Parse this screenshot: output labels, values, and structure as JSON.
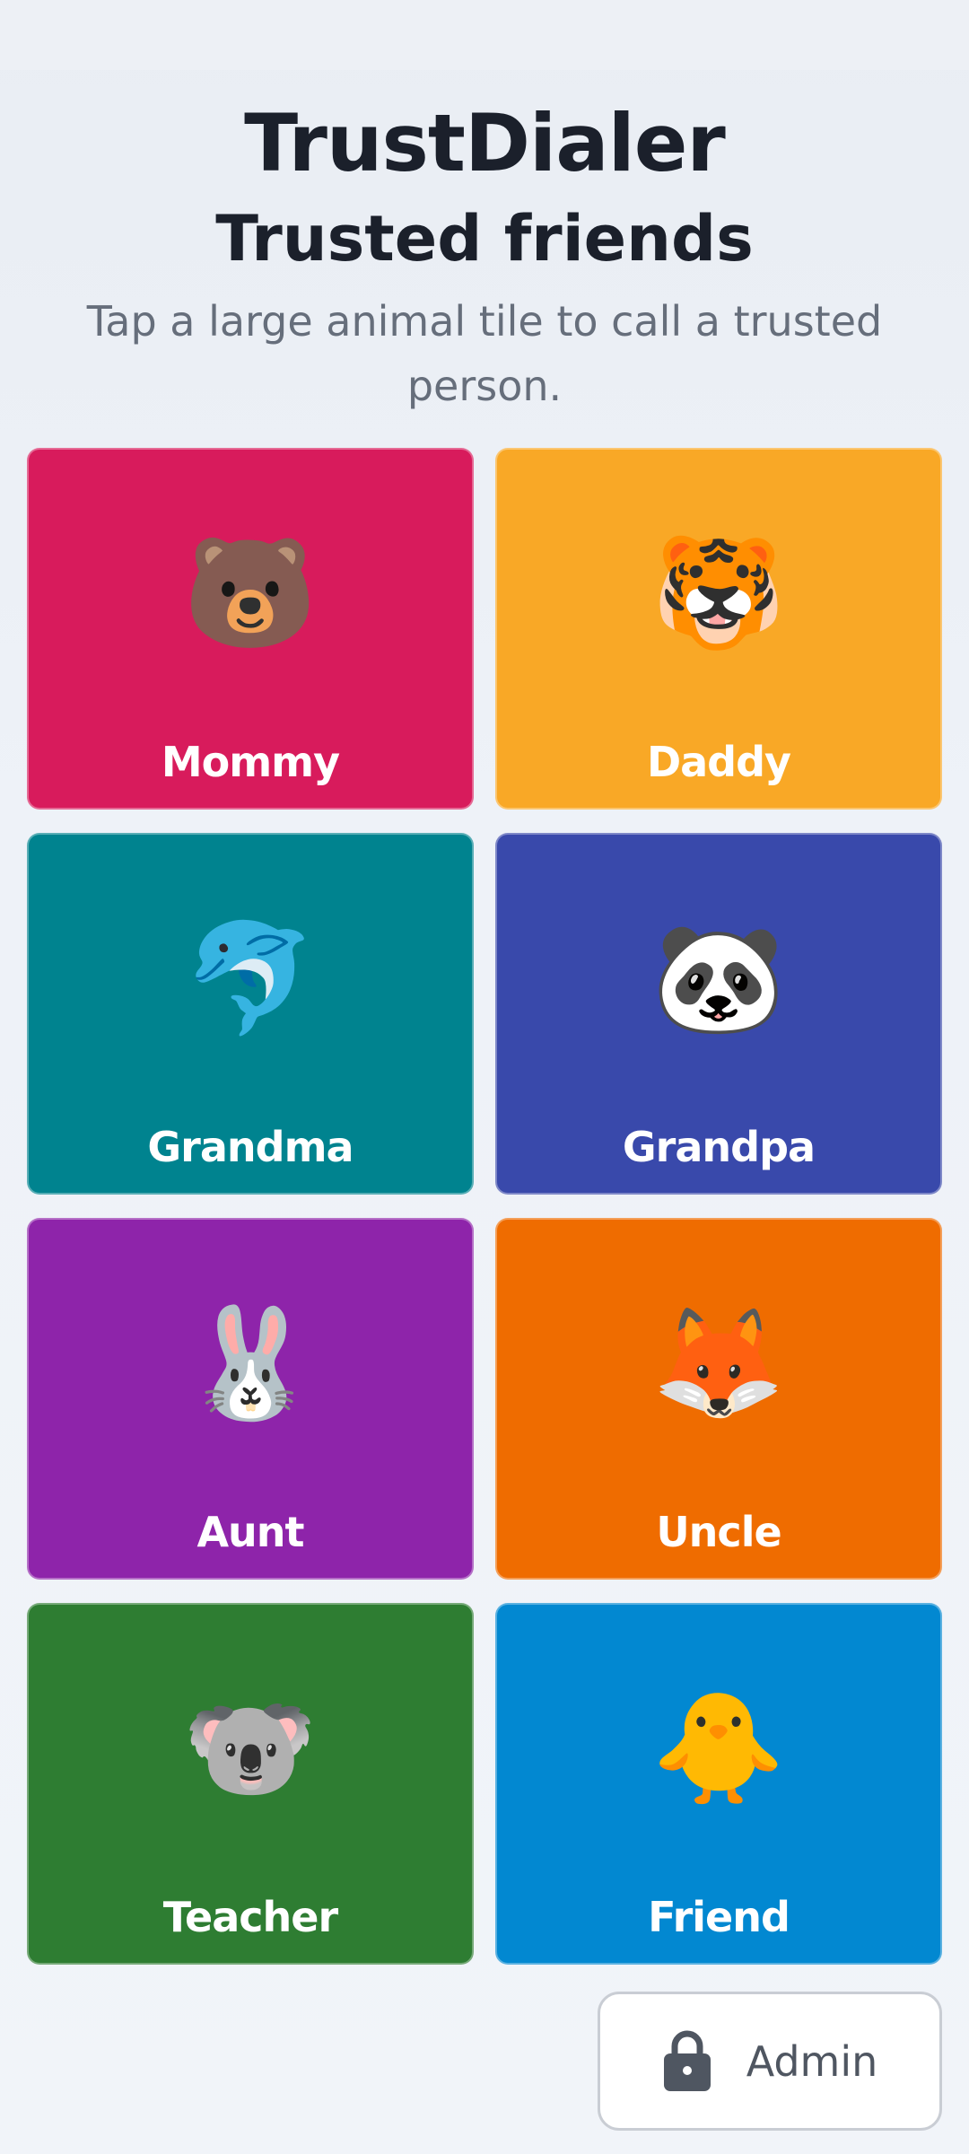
{
  "header": {
    "app_title": "TrustDialer",
    "subtitle": "Trusted friends",
    "instructions": "Tap a large animal tile to call a trusted person."
  },
  "contacts": [
    {
      "label": "Mommy",
      "emoji": "🐻",
      "icon": "bear-icon",
      "color": "#d81b5c"
    },
    {
      "label": "Daddy",
      "emoji": "🐯",
      "icon": "tiger-icon",
      "color": "#f9a826"
    },
    {
      "label": "Grandma",
      "emoji": "🐬",
      "icon": "dolphin-icon",
      "color": "#00838f"
    },
    {
      "label": "Grandpa",
      "emoji": "🐼",
      "icon": "panda-icon",
      "color": "#3949ab"
    },
    {
      "label": "Aunt",
      "emoji": "🐰",
      "icon": "rabbit-icon",
      "color": "#8e24aa"
    },
    {
      "label": "Uncle",
      "emoji": "🦊",
      "icon": "fox-icon",
      "color": "#ef6c00"
    },
    {
      "label": "Teacher",
      "emoji": "🐨",
      "icon": "koala-icon",
      "color": "#2e7d32"
    },
    {
      "label": "Friend",
      "emoji": "🐥",
      "icon": "chick-icon",
      "color": "#0288d1"
    }
  ],
  "admin": {
    "label": "Admin",
    "icon": "lock-icon"
  }
}
